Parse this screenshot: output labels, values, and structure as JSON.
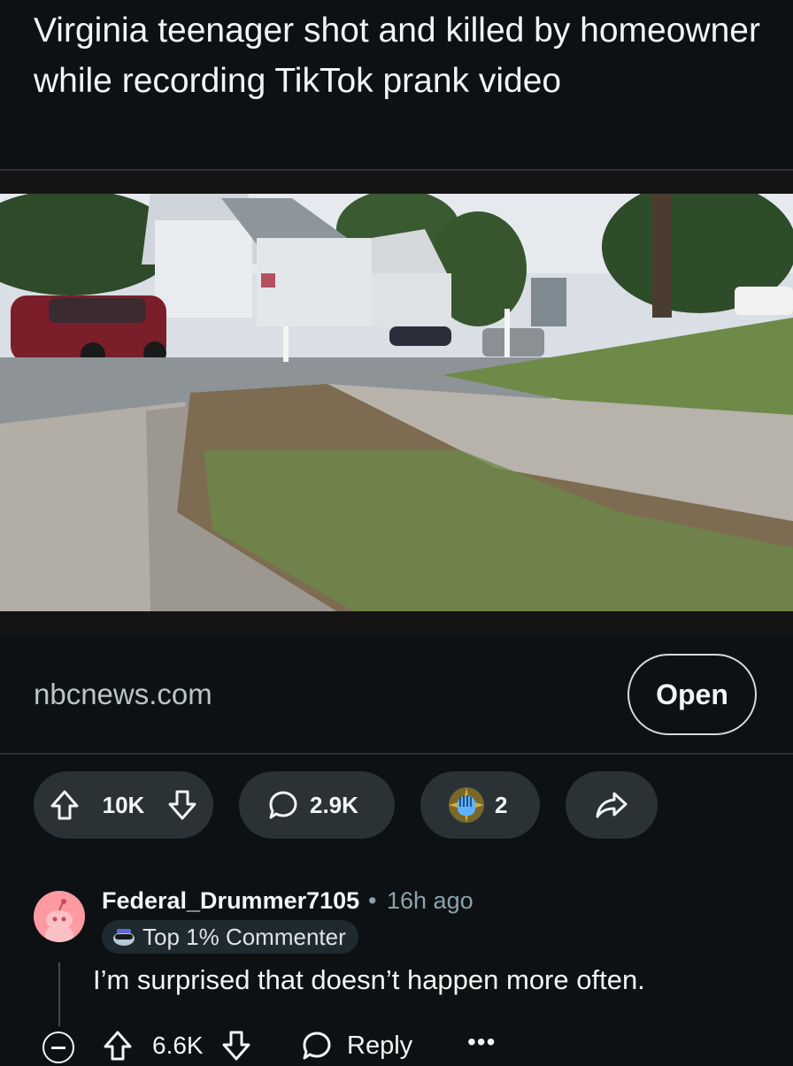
{
  "post": {
    "title": "Virginia teenager shot and killed by homeowner while recording TikTok prank video",
    "link_domain": "nbcnews.com",
    "open_label": "Open",
    "vote_count": "10K",
    "comment_count": "2.9K",
    "award_count": "2"
  },
  "comment": {
    "username": "Federal_Drummer7105",
    "separator": "•",
    "time": "16h ago",
    "flair": "Top 1% Commenter",
    "body": "I’m surprised that doesn’t happen more often.",
    "score": "6.6K",
    "reply_label": "Reply",
    "more_label": "•••"
  },
  "colors": {
    "background": "#0e1113",
    "pill": "#2a3236",
    "text": "#f2f4f5",
    "meta": "#8ba2ad",
    "avatar": "#ff9aa2"
  },
  "icons": [
    "upvote-icon",
    "downvote-icon",
    "comment-icon",
    "award-icon",
    "share-icon",
    "collapse-icon",
    "more-icon"
  ]
}
